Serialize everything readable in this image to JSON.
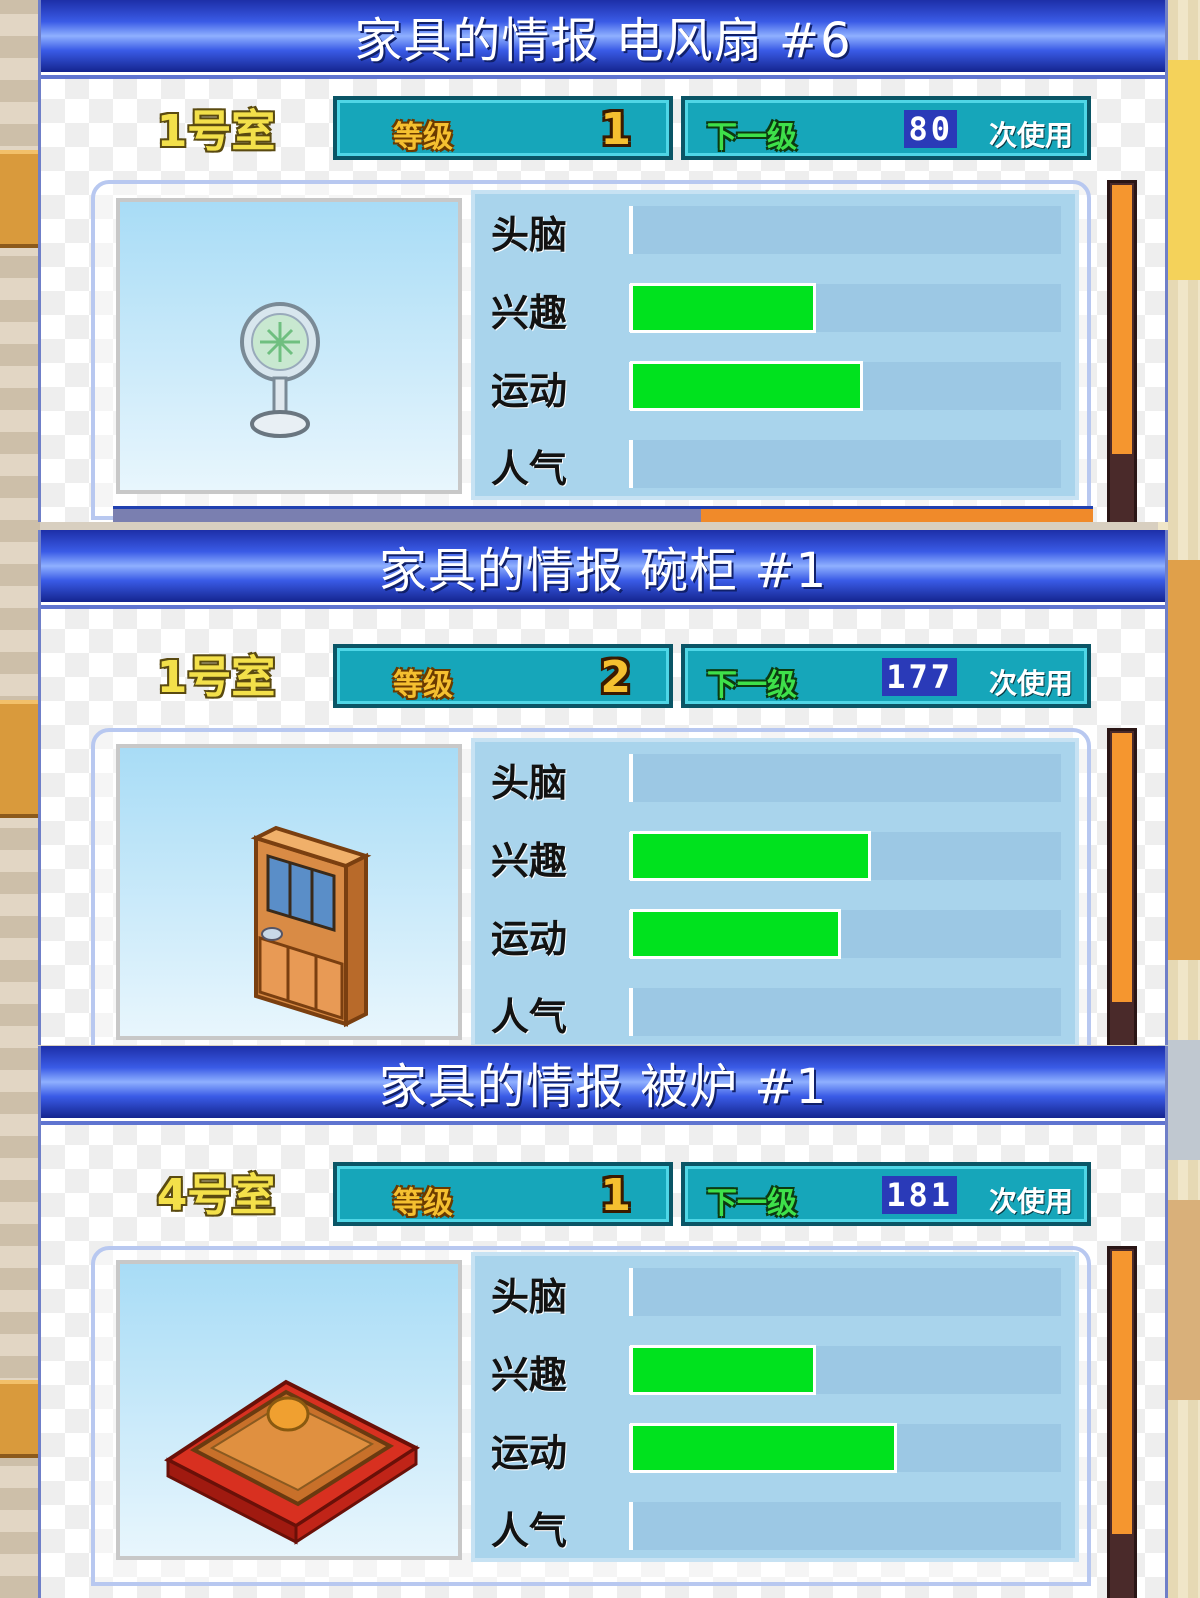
{
  "panels": [
    {
      "title": "家具的情报 电风扇 #6",
      "room": "1号室",
      "level_label": "等级",
      "level_value": "1",
      "next_label": "下一级",
      "uses_value": "80",
      "uses_label": "次使用",
      "item_icon": "electric-fan-icon",
      "stats": [
        {
          "label": "头脑",
          "value": 0
        },
        {
          "label": "兴趣",
          "value": 0.42
        },
        {
          "label": "运动",
          "value": 0.53
        },
        {
          "label": "人气",
          "value": 0
        }
      ],
      "scroll_fraction": 0.76
    },
    {
      "title": "家具的情报 碗柜 #1",
      "room": "1号室",
      "level_label": "等级",
      "level_value": "2",
      "next_label": "下一级",
      "uses_value": "177",
      "uses_label": "次使用",
      "item_icon": "cupboard-icon",
      "stats": [
        {
          "label": "头脑",
          "value": 0
        },
        {
          "label": "兴趣",
          "value": 0.55
        },
        {
          "label": "运动",
          "value": 0.48
        },
        {
          "label": "人气",
          "value": 0
        }
      ],
      "scroll_fraction": 0.76
    },
    {
      "title": "家具的情报 被炉 #1",
      "room": "4号室",
      "level_label": "等级",
      "level_value": "1",
      "next_label": "下一级",
      "uses_value": "181",
      "uses_label": "次使用",
      "item_icon": "kotatsu-icon",
      "stats": [
        {
          "label": "头脑",
          "value": 0
        },
        {
          "label": "兴趣",
          "value": 0.42
        },
        {
          "label": "运动",
          "value": 0.61
        },
        {
          "label": "人气",
          "value": 0
        }
      ],
      "scroll_fraction": 0.8
    }
  ],
  "colors": {
    "stat_fill": "#00e21e",
    "title_bar": "#2a44c8",
    "scroll_thumb": "#f5962f",
    "level_box": "#16a6ba"
  }
}
